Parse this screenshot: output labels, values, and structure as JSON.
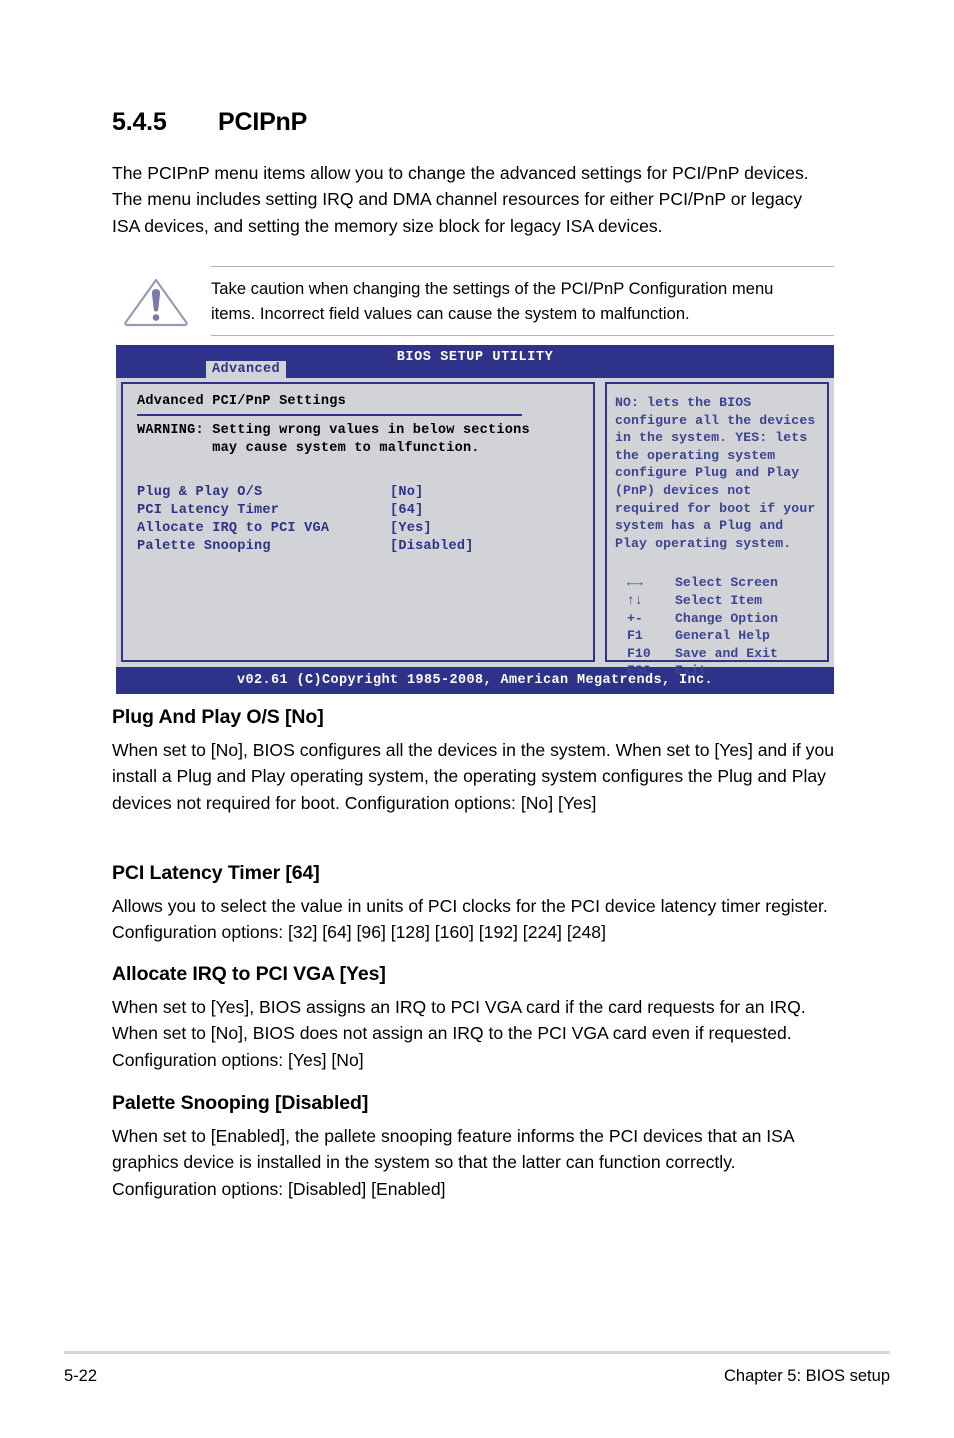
{
  "section": {
    "number": "5.4.5",
    "title": "PCIPnP",
    "intro": "The PCIPnP menu items allow you to change the advanced settings for PCI/PnP devices. The menu includes setting IRQ and DMA channel resources for either PCI/PnP or legacy ISA devices, and setting the memory size block for legacy ISA devices."
  },
  "note": {
    "icon": "caution-triangle-icon",
    "text": "Take caution when changing the settings of the PCI/PnP Configuration menu items. Incorrect field values can cause the system to malfunction."
  },
  "bios": {
    "title": "BIOS SETUP UTILITY",
    "tab": "Advanced",
    "panel_title": "Advanced PCI/PnP Settings",
    "warning_line1": "WARNING: Setting wrong values in below sections",
    "warning_line2": "         may cause system to malfunction.",
    "items": [
      {
        "label": "Plug & Play O/S",
        "value": "[No]"
      },
      {
        "label": "PCI Latency Timer",
        "value": "[64]"
      },
      {
        "label": "Allocate IRQ to PCI VGA",
        "value": "[Yes]"
      },
      {
        "label": "Palette Snooping",
        "value": "[Disabled]"
      }
    ],
    "help": "NO: lets the BIOS configure all the devices in the system. YES: lets the operating system configure Plug and Play (PnP) devices not required for boot if your system has a Plug and Play operating system.",
    "keys": [
      {
        "key": "←→",
        "desc": "Select Screen"
      },
      {
        "key": "↑↓",
        "desc": "Select Item"
      },
      {
        "key": "+-",
        "desc": "Change Option"
      },
      {
        "key": "F1",
        "desc": "General Help"
      },
      {
        "key": "F10",
        "desc": "Save and Exit"
      },
      {
        "key": "ESC",
        "desc": "Exit"
      }
    ],
    "footer": "v02.61 (C)Copyright 1985-2008, American Megatrends, Inc.",
    "colors": {
      "header_blue": "#2e3288",
      "body_gray": "#d2d3d7",
      "text_blue": "#3b4491"
    }
  },
  "subsections": [
    {
      "heading": "Plug And Play O/S [No]",
      "body": "When set to [No], BIOS configures all the devices in the system. When set to [Yes] and if you install a Plug and Play operating system, the operating system configures the Plug and Play devices not required for boot.\nConfiguration options: [No] [Yes]"
    },
    {
      "heading": "PCI Latency Timer [64]",
      "body": "Allows you to select the value in units of PCI clocks for the PCI device latency timer register. Configuration options: [32] [64] [96] [128] [160] [192] [224] [248]"
    },
    {
      "heading": "Allocate IRQ to PCI VGA [Yes]",
      "body": "When set to [Yes], BIOS assigns an IRQ to PCI VGA card if the card requests for an IRQ. When set to [No], BIOS does not assign an IRQ to the PCI VGA card even if requested. Configuration options: [Yes] [No]"
    },
    {
      "heading": "Palette Snooping [Disabled]",
      "body": "When set to [Enabled], the pallete snooping feature informs the PCI devices that an ISA graphics device is installed in the system so that the latter can function correctly. Configuration options: [Disabled] [Enabled]"
    }
  ],
  "page_footer": {
    "page_number": "5-22",
    "chapter": "Chapter 5: BIOS setup"
  }
}
